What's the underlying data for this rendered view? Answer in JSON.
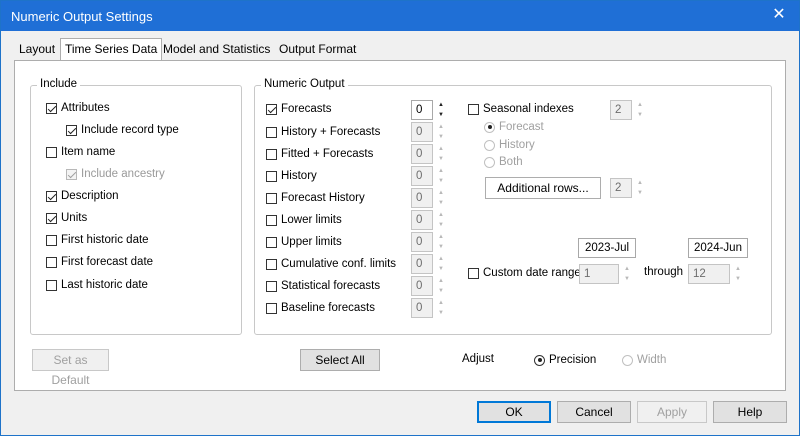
{
  "window": {
    "title": "Numeric Output Settings"
  },
  "tabs": [
    {
      "label": "Layout",
      "active": false
    },
    {
      "label": "Time Series Data",
      "active": true
    },
    {
      "label": "Model and Statistics",
      "active": false
    },
    {
      "label": "Output Format",
      "active": false
    }
  ],
  "include": {
    "legend": "Include",
    "items": [
      {
        "label": "Attributes",
        "checked": true,
        "disabled": false
      },
      {
        "label": "Include record type",
        "checked": true,
        "disabled": false
      },
      {
        "label": "Item name",
        "checked": false,
        "disabled": false
      },
      {
        "label": "Include ancestry",
        "checked": true,
        "disabled": true
      },
      {
        "label": "Description",
        "checked": true,
        "disabled": false
      },
      {
        "label": "Units",
        "checked": true,
        "disabled": false
      },
      {
        "label": "First historic date",
        "checked": false,
        "disabled": false
      },
      {
        "label": "First forecast date",
        "checked": false,
        "disabled": false
      },
      {
        "label": "Last historic date",
        "checked": false,
        "disabled": false
      }
    ]
  },
  "numeric_output": {
    "legend": "Numeric Output",
    "items": [
      {
        "label": "Forecasts",
        "checked": true,
        "value": "0",
        "enabled": true
      },
      {
        "label": "History + Forecasts",
        "checked": false,
        "value": "0",
        "enabled": false
      },
      {
        "label": "Fitted + Forecasts",
        "checked": false,
        "value": "0",
        "enabled": false
      },
      {
        "label": "History",
        "checked": false,
        "value": "0",
        "enabled": false
      },
      {
        "label": "Forecast History",
        "checked": false,
        "value": "0",
        "enabled": false
      },
      {
        "label": "Lower limits",
        "checked": false,
        "value": "0",
        "enabled": false
      },
      {
        "label": "Upper limits",
        "checked": false,
        "value": "0",
        "enabled": false
      },
      {
        "label": "Cumulative conf. limits",
        "checked": false,
        "value": "0",
        "enabled": false
      },
      {
        "label": "Statistical forecasts",
        "checked": false,
        "value": "0",
        "enabled": false
      },
      {
        "label": "Baseline forecasts",
        "checked": false,
        "value": "0",
        "enabled": false
      }
    ],
    "seasonal": {
      "label": "Seasonal indexes",
      "checked": false,
      "value": "2",
      "options": [
        {
          "label": "Forecast",
          "selected": true
        },
        {
          "label": "History",
          "selected": false
        },
        {
          "label": "Both",
          "selected": false
        }
      ]
    },
    "additional_rows": {
      "label": "Additional rows...",
      "value": "2"
    },
    "custom_range": {
      "label": "Custom date range",
      "checked": false,
      "start_date": "2023-Jul",
      "start_value": "1",
      "through": "through",
      "end_date": "2024-Jun",
      "end_value": "12"
    }
  },
  "bottom": {
    "set_default": "Set as Default",
    "select_all": "Select All",
    "adjust": "Adjust",
    "precision": "Precision",
    "width": "Width"
  },
  "buttons": {
    "ok": "OK",
    "cancel": "Cancel",
    "apply": "Apply",
    "help": "Help"
  }
}
